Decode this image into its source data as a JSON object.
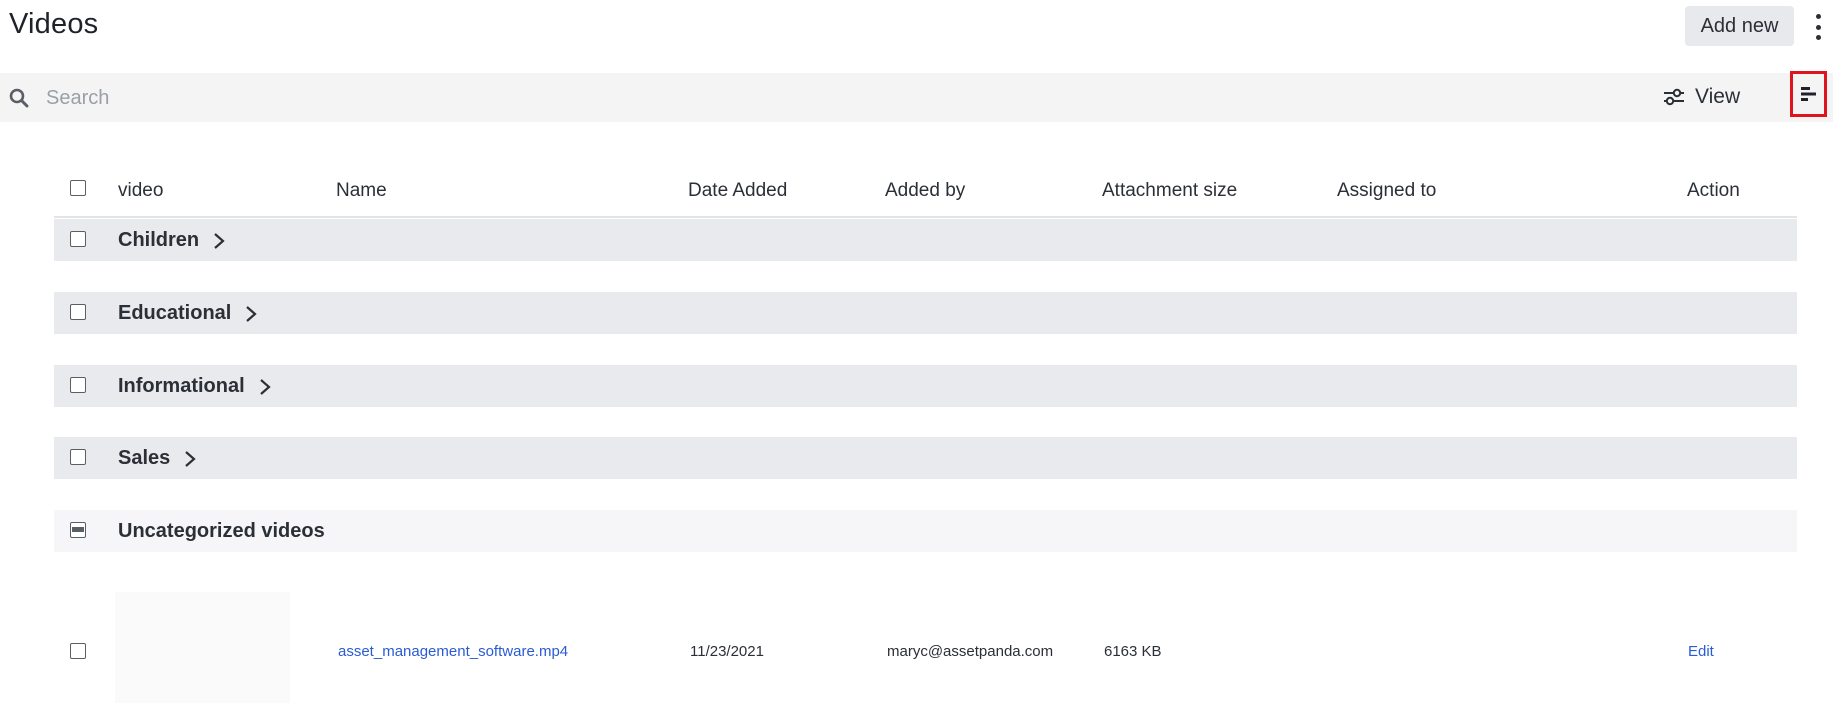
{
  "header": {
    "title": "Videos",
    "add_new_label": "Add new"
  },
  "search": {
    "placeholder": "Search",
    "value": ""
  },
  "toolbar": {
    "view_label": "View"
  },
  "table": {
    "columns": [
      "video",
      "Name",
      "Date Added",
      "Added by",
      "Attachment size",
      "Assigned to",
      "Action"
    ],
    "groups": [
      {
        "label": "Children",
        "collapsed": true
      },
      {
        "label": "Educational",
        "collapsed": true
      },
      {
        "label": "Informational",
        "collapsed": true
      },
      {
        "label": "Sales",
        "collapsed": true
      },
      {
        "label": "Uncategorized videos",
        "collapsed": false
      }
    ],
    "rows": [
      {
        "name": "asset_management_software.mp4",
        "date_added": "11/23/2021",
        "added_by": "maryc@assetpanda.com",
        "attachment_size": "6163 KB",
        "assigned_to": "",
        "action": "Edit"
      }
    ]
  },
  "colors": {
    "accent_link": "#2a5bd7",
    "highlight_border": "#e0141e",
    "group_bg": "#e9eaee",
    "searchbar_bg": "#f4f4f5"
  }
}
